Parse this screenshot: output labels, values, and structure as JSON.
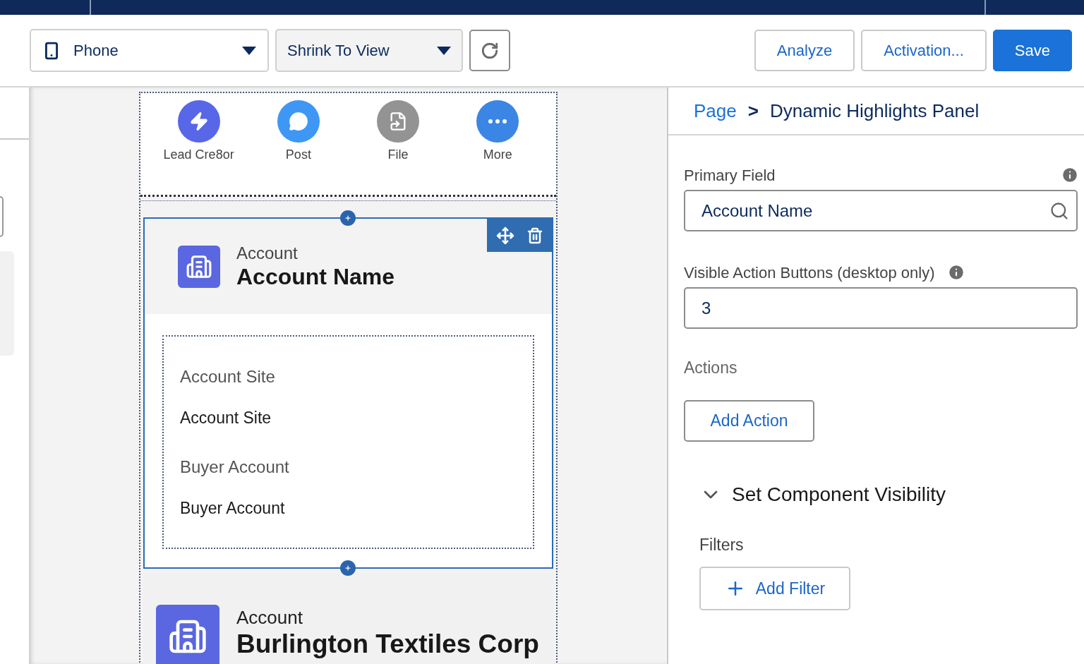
{
  "toolbar": {
    "device": {
      "label": "Phone"
    },
    "zoom": {
      "label": "Shrink To View"
    },
    "buttons": [
      {
        "label": "Analyze",
        "kind": "outline"
      },
      {
        "label": "Activation...",
        "kind": "outline"
      },
      {
        "label": "Save",
        "kind": "primary"
      }
    ]
  },
  "canvas": {
    "actions": [
      {
        "label": "Lead Cre8or",
        "kind": "bolt",
        "color": "#5867e8"
      },
      {
        "label": "Post",
        "kind": "chat",
        "color": "#3f97f5"
      },
      {
        "label": "File",
        "kind": "file",
        "color": "#939393"
      },
      {
        "label": "More",
        "kind": "more",
        "color": "#3b86e4"
      }
    ],
    "selected_component": {
      "object": "Account",
      "title": "Account Name",
      "selected": true,
      "fields": [
        {
          "label": "Account Site",
          "value": "Account Site"
        },
        {
          "label": "Buyer Account",
          "value": "Buyer Account"
        }
      ]
    },
    "next_component": {
      "object": "Account",
      "title": "Burlington Textiles Corp"
    }
  },
  "properties": {
    "breadcrumb": {
      "parent": "Page",
      "separator": ">",
      "current": "Dynamic Highlights Panel"
    },
    "primary_field": {
      "label": "Primary Field",
      "value": "Account Name"
    },
    "visible_actions": {
      "label": "Visible Action Buttons (desktop only)",
      "value": "3"
    },
    "actions": {
      "label": "Actions",
      "button": "Add Action"
    },
    "visibility": {
      "title": "Set Component Visibility",
      "expanded": true,
      "filters_label": "Filters",
      "add_filter": "Add Filter"
    }
  }
}
